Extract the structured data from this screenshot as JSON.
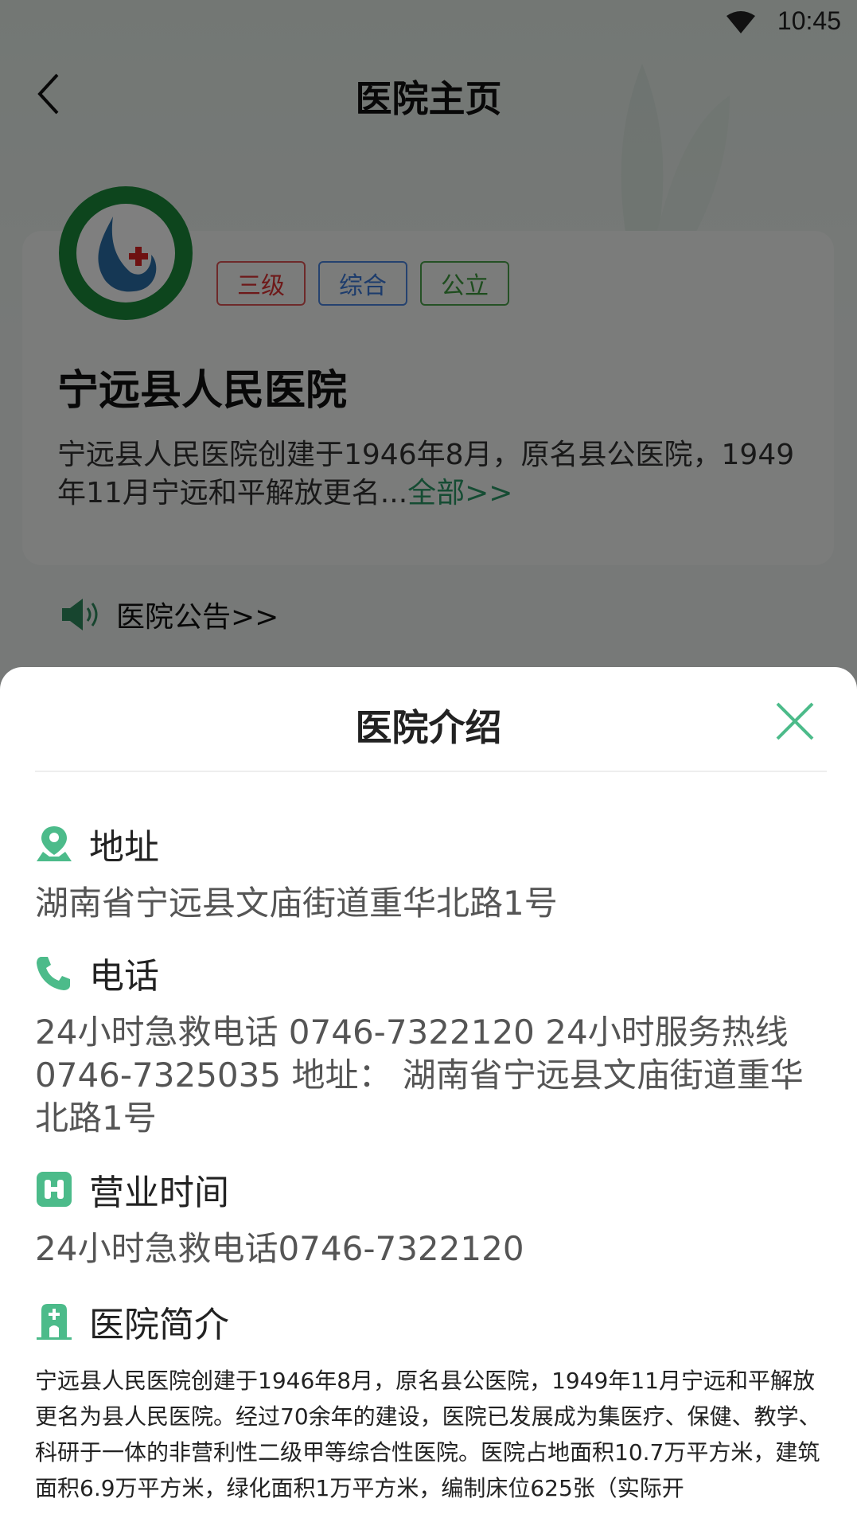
{
  "status_bar": {
    "time": "10:45",
    "wifi_icon": "wifi-icon"
  },
  "nav": {
    "back_icon": "chevron-left-icon",
    "title": "医院主页"
  },
  "hospital": {
    "logo_icon": "hospital-logo",
    "tags": [
      {
        "label": "三级",
        "color": "#d33333"
      },
      {
        "label": "综合",
        "color": "#3a78d8"
      },
      {
        "label": "公立",
        "color": "#3d9a3d"
      }
    ],
    "name": "宁远县人民医院",
    "summary": " 宁远县人民医院创建于1946年8月，原名县公医院，1949年11月宁远和平解放更名...",
    "more_link": "全部>>",
    "notice_icon": "speaker-icon",
    "notice_label": "医院公告>>"
  },
  "sheet": {
    "title": "医院介绍",
    "close_icon": "close-icon",
    "accent_color": "#4cbb8a",
    "sections": {
      "address": {
        "icon": "location-pin-icon",
        "label": "地址",
        "value": "湖南省宁远县文庙街道重华北路1号"
      },
      "phone": {
        "icon": "phone-icon",
        "label": "电话",
        "value": "24小时急救电话 0746-7322120 24小时服务热线 0746-7325035 地址： 湖南省宁远县文庙街道重华北路1号"
      },
      "hours": {
        "icon": "hours-icon",
        "label": "营业时间",
        "value": "24小时急救电话0746-7322120"
      },
      "intro": {
        "icon": "hospital-building-icon",
        "label": "医院简介",
        "value": "宁远县人民医院创建于1946年8月，原名县公医院，1949年11月宁远和平解放更名为县人民医院。经过70余年的建设，医院已发展成为集医疗、保健、教学、科研于一体的非营利性二级甲等综合性医院。医院占地面积10.7万平方米，建筑面积6.9万平方米，绿化面积1万平方米，编制床位625张（实际开"
      }
    }
  }
}
